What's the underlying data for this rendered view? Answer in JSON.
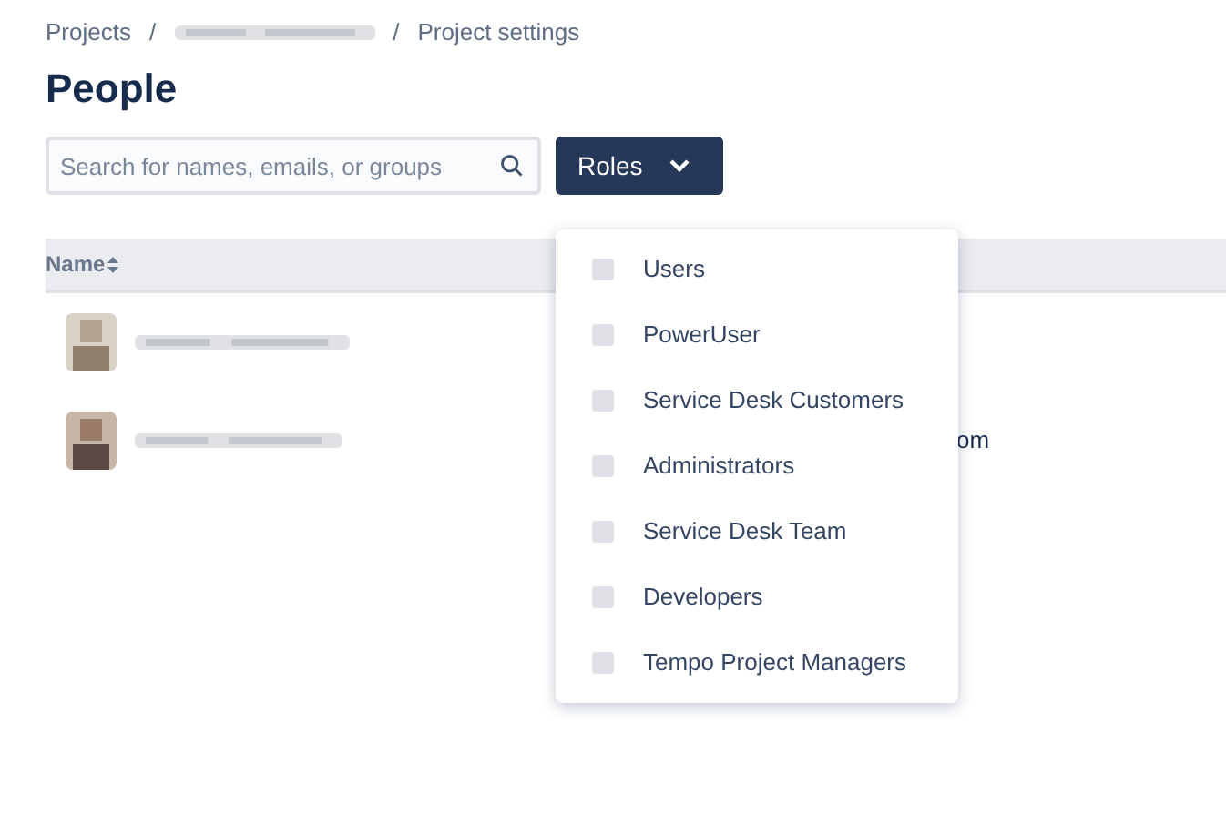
{
  "breadcrumbs": [
    {
      "kind": "link",
      "label": "Projects"
    },
    {
      "kind": "redacted"
    },
    {
      "kind": "link",
      "label": "Project settings"
    }
  ],
  "breadcrumb_separator": "/",
  "title": "People",
  "search": {
    "placeholder": "Search for names, emails, or groups"
  },
  "roles_button": {
    "label": "Roles",
    "expanded": true
  },
  "table": {
    "columns": [
      {
        "label": "Name",
        "sortable": true
      }
    ],
    "rows": [
      {
        "kind": "person"
      },
      {
        "kind": "person",
        "column_2": "om"
      }
    ]
  },
  "roles_menu": [
    {
      "label": "Users",
      "checked": false
    },
    {
      "label": "PowerUser",
      "checked": false
    },
    {
      "label": "Service Desk Customers",
      "checked": false
    },
    {
      "label": "Administrators",
      "checked": false
    },
    {
      "label": "Service Desk Team",
      "checked": false
    },
    {
      "label": "Developers",
      "checked": false
    },
    {
      "label": "Tempo Project Managers",
      "checked": false
    }
  ]
}
